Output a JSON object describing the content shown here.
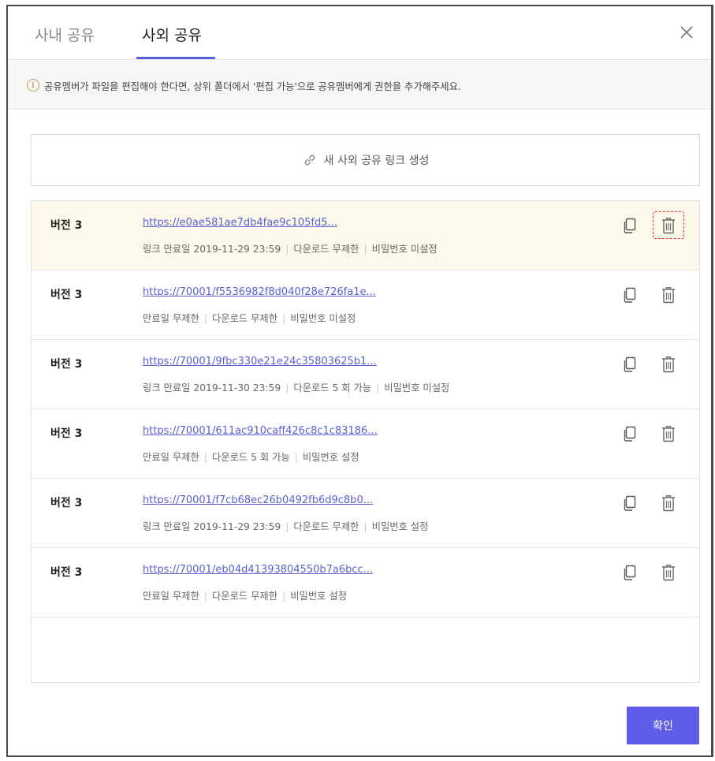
{
  "tabs": [
    {
      "label": "사내 공유",
      "active": false
    },
    {
      "label": "사외 공유",
      "active": true
    }
  ],
  "info": {
    "icon": "info-icon",
    "icon_glyph": "i",
    "text": "공유멤버가 파일을 편집해야 한다면, 상위 폴더에서 '편집 가능'으로 공유멤버에게 권한을 추가해주세요."
  },
  "create_link": {
    "icon": "link-icon",
    "label": "새 사외 공유 링크 생성"
  },
  "links": [
    {
      "version": "버전 3",
      "url": "https://e0ae581ae7db4fae9c105fd5...",
      "expiry": "링크 만료일 2019-11-29 23:59",
      "download": "다운로드 무제한",
      "password": "비밀번호 미설정",
      "highlighted": true
    },
    {
      "version": "버전 3",
      "url": "https://70001/f5536982f8d040f28e726fa1e...",
      "expiry": "만료일 무제한",
      "download": "다운로드 무제한",
      "password": "비밀번호 미설정",
      "highlighted": false
    },
    {
      "version": "버전 3",
      "url": "https://70001/9fbc330e21e24c35803625b1...",
      "expiry": "링크 만료일 2019-11-30 23:59",
      "download": "다운로드 5 회 가능",
      "password": "비밀번호 미설정",
      "highlighted": false
    },
    {
      "version": "버전 3",
      "url": "https://70001/611ac910caff426c8c1c83186...",
      "expiry": "만료일 무제한",
      "download": "다운로드 5 회 가능",
      "password": "비밀번호 설정",
      "highlighted": false
    },
    {
      "version": "버전 3",
      "url": "https://70001/f7cb68ec26b0492fb6d9c8b0...",
      "expiry": "링크 만료일 2019-11-29 23:59",
      "download": "다운로드 무제한",
      "password": "비밀번호 설정",
      "highlighted": false
    },
    {
      "version": "버전 3",
      "url": "https://70001/eb04d41393804550b7a6bcc...",
      "expiry": "만료일 무제한",
      "download": "다운로드 무제한",
      "password": "비밀번호 설정",
      "highlighted": false
    }
  ],
  "confirm_label": "확인",
  "colors": {
    "accent": "#5f5ce8",
    "link": "#5c5fd0",
    "highlight": "#fcf8ea",
    "focus": "#e0312b"
  }
}
